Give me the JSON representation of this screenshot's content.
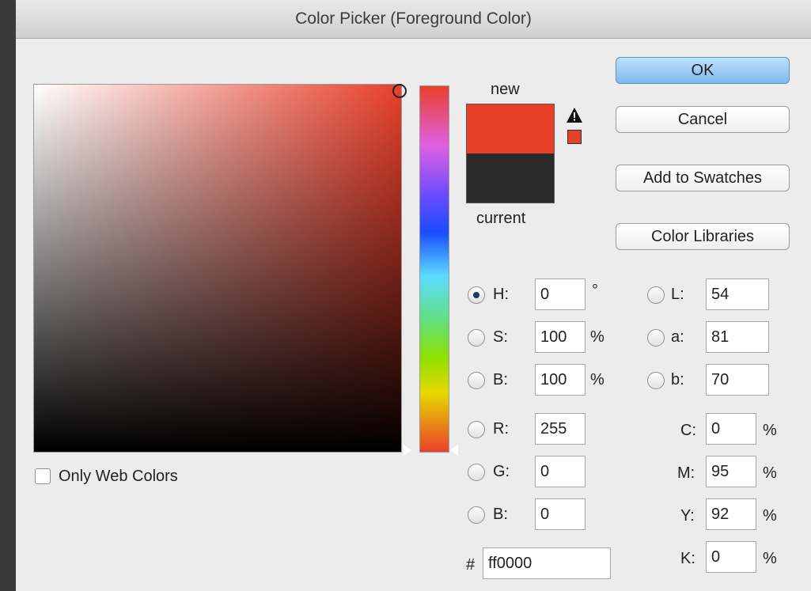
{
  "window": {
    "title": "Color Picker (Foreground Color)"
  },
  "swatch": {
    "new_label": "new",
    "current_label": "current",
    "new_color": "#e9402b",
    "current_color": "#2a2a2a"
  },
  "gamut_warning": {
    "swatch_color": "#e5402b",
    "icon": "warning-triangle-icon"
  },
  "buttons": {
    "ok": "OK",
    "cancel": "Cancel",
    "add_swatches": "Add to Swatches",
    "color_libraries": "Color Libraries"
  },
  "only_web_colors": {
    "label": "Only Web Colors",
    "checked": false
  },
  "hsb": {
    "h": {
      "label": "H:",
      "value": "0",
      "unit": "°",
      "selected": true
    },
    "s": {
      "label": "S:",
      "value": "100",
      "unit": "%"
    },
    "b": {
      "label": "B:",
      "value": "100",
      "unit": "%"
    }
  },
  "rgb": {
    "r": {
      "label": "R:",
      "value": "255"
    },
    "g": {
      "label": "G:",
      "value": "0"
    },
    "b": {
      "label": "B:",
      "value": "0"
    }
  },
  "lab": {
    "l": {
      "label": "L:",
      "value": "54"
    },
    "a": {
      "label": "a:",
      "value": "81"
    },
    "b": {
      "label": "b:",
      "value": "70"
    }
  },
  "cmyk": {
    "c": {
      "label": "C:",
      "value": "0",
      "unit": "%"
    },
    "m": {
      "label": "M:",
      "value": "95",
      "unit": "%"
    },
    "y": {
      "label": "Y:",
      "value": "92",
      "unit": "%"
    },
    "k": {
      "label": "K:",
      "value": "0",
      "unit": "%"
    }
  },
  "hex": {
    "label": "#",
    "value": "ff0000"
  },
  "colors": {
    "accent_ok": "#7fb8ef"
  }
}
